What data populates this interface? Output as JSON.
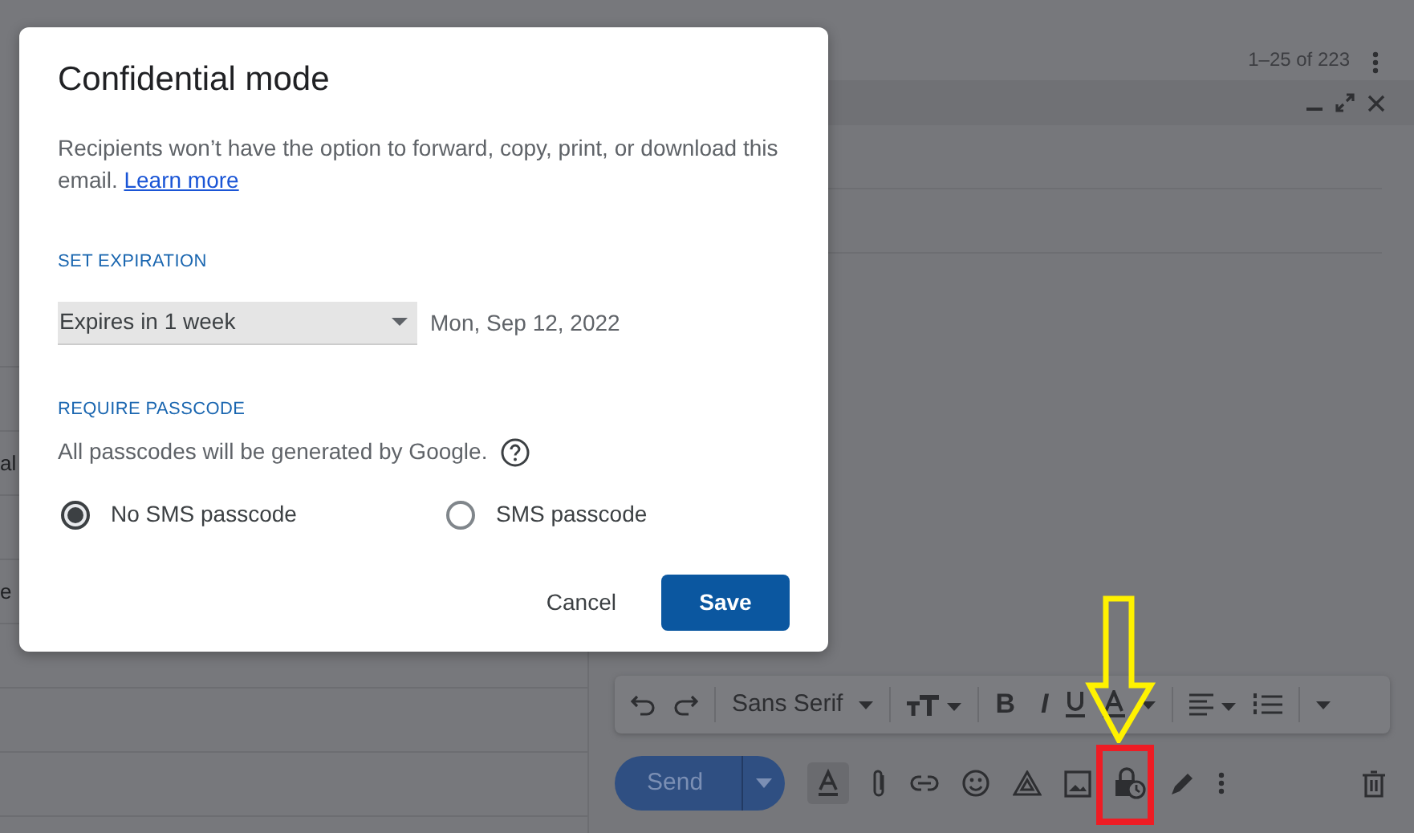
{
  "inbox": {
    "page_range": "1–25 of 223",
    "row_fragments": [
      {
        "text": "al"
      },
      {
        "text": "e"
      }
    ]
  },
  "format_toolbar": {
    "font": "Sans Serif",
    "glyphs": [
      "B",
      "I"
    ]
  },
  "send_button": {
    "label": "Send"
  },
  "dialog": {
    "title": "Confidential mode",
    "description": "Recipients won’t have the option to forward, copy, print, or download this email.",
    "learn_more": "Learn more",
    "expiration_heading": "SET EXPIRATION",
    "expiration": {
      "value": "Expires in 1 week"
    },
    "expiry_date": "Mon, Sep 12, 2022",
    "passcode_heading": "REQUIRE PASSCODE",
    "passcode_note": "All passcodes will be generated by Google.",
    "passcode_options": [
      {
        "label": "No SMS passcode",
        "selected": true
      },
      {
        "label": "SMS passcode",
        "selected": false
      }
    ],
    "buttons": [
      {
        "label": "Cancel",
        "kind": "text"
      },
      {
        "label": "Save",
        "kind": "primary"
      }
    ]
  }
}
